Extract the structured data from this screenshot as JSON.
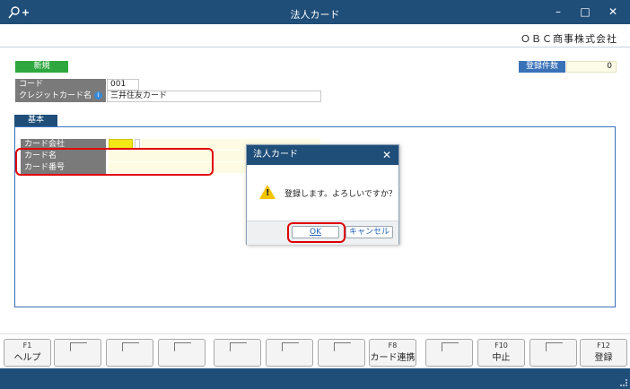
{
  "window": {
    "title": "法人カード",
    "minimize_glyph": "–",
    "maximize_glyph": "□",
    "close_glyph": "✕"
  },
  "header": {
    "company": "ＯＢＣ商事株式会社",
    "mode_badge": "新規",
    "registered_count_label": "登録件数",
    "registered_count_value": "0"
  },
  "form": {
    "code_label": "コード",
    "code_value": "001",
    "credit_card_label": "クレジットカード名",
    "credit_card_value": "三井住友カード",
    "tab_basic": "基本",
    "card_company_label": "カード会社",
    "card_name_label": "カード名",
    "card_number_label": "カード番号"
  },
  "dialog": {
    "title": "法人カード",
    "close_glyph": "✕",
    "message": "登録します。よろしいですか？",
    "ok_label": "OK",
    "cancel_label": "キャンセル"
  },
  "fkeys": [
    {
      "num": "F1",
      "label": "ヘルプ"
    },
    {
      "num": "",
      "label": ""
    },
    {
      "num": "",
      "label": ""
    },
    {
      "num": "",
      "label": ""
    },
    {
      "num": "",
      "label": ""
    },
    {
      "num": "",
      "label": ""
    },
    {
      "num": "",
      "label": ""
    },
    {
      "num": "F8",
      "label": "カード連携"
    },
    {
      "num": "",
      "label": ""
    },
    {
      "num": "F10",
      "label": "中止"
    },
    {
      "num": "",
      "label": ""
    },
    {
      "num": "F12",
      "label": "登録"
    }
  ],
  "colors": {
    "titlebar": "#1f4e79",
    "new_badge": "#2ea83e",
    "highlight": "#e00000"
  }
}
